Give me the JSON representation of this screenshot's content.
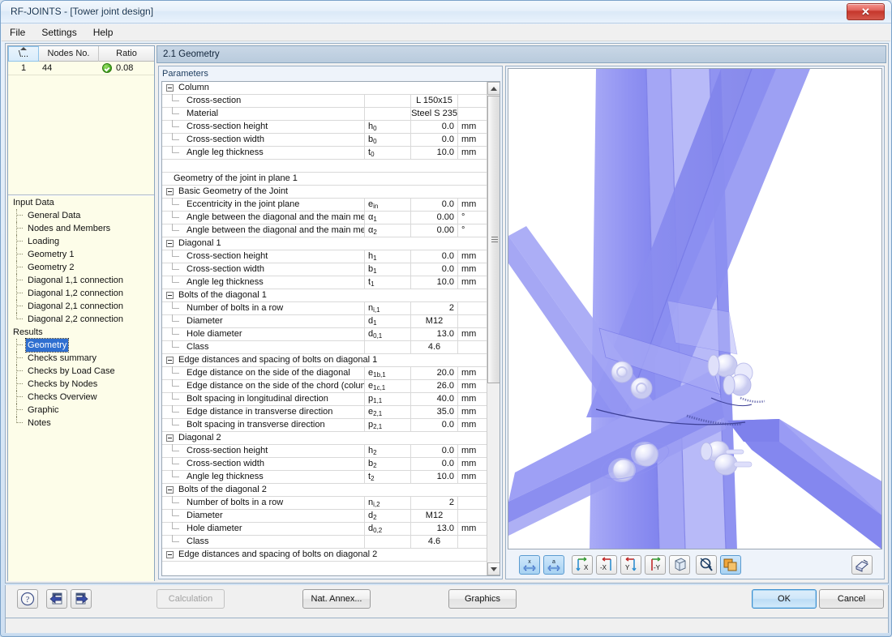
{
  "window": {
    "title": "RF-JOINTS - [Tower joint design]",
    "close_label": "✕"
  },
  "menu": {
    "items": [
      {
        "label": "File"
      },
      {
        "label": "Settings"
      },
      {
        "label": "Help"
      }
    ]
  },
  "nodes_grid": {
    "columns": [
      "\\...",
      "Nodes No.",
      "Ratio"
    ],
    "rows": [
      {
        "no": "1",
        "node": "44",
        "ratio": "0.08",
        "status_icon": "green-check-icon"
      }
    ]
  },
  "nav": {
    "groups": [
      {
        "label": "Input Data",
        "items": [
          {
            "label": "General Data"
          },
          {
            "label": "Nodes and Members"
          },
          {
            "label": "Loading"
          },
          {
            "label": "Geometry 1"
          },
          {
            "label": "Geometry 2"
          },
          {
            "label": "Diagonal 1,1 connection"
          },
          {
            "label": "Diagonal 1,2 connection"
          },
          {
            "label": "Diagonal 2,1 connection"
          },
          {
            "label": "Diagonal 2,2 connection"
          }
        ]
      },
      {
        "label": "Results",
        "items": [
          {
            "label": "Geometry",
            "selected": true
          },
          {
            "label": "Checks summary"
          },
          {
            "label": "Checks by Load Case"
          },
          {
            "label": "Checks by Nodes"
          },
          {
            "label": "Checks Overview"
          },
          {
            "label": "Graphic"
          },
          {
            "label": "Notes"
          }
        ]
      }
    ]
  },
  "content": {
    "header": "2.1 Geometry",
    "parameters_label": "Parameters"
  },
  "table": {
    "rows": [
      {
        "kind": "group",
        "name": "Column"
      },
      {
        "kind": "leaf",
        "name": "Cross-section",
        "sym": "",
        "val": "L 150x15",
        "unit": "",
        "val_align": "center"
      },
      {
        "kind": "leaf",
        "name": "Material",
        "sym": "",
        "val": "Steel S 235",
        "unit": "",
        "val_align": "center"
      },
      {
        "kind": "leaf",
        "name": "Cross-section height",
        "sym": "h",
        "sub": "0",
        "val": "0.0",
        "unit": "mm"
      },
      {
        "kind": "leaf",
        "name": "Cross-section width",
        "sym": "b",
        "sub": "0",
        "val": "0.0",
        "unit": "mm"
      },
      {
        "kind": "leaf",
        "name": "Angle leg thickness",
        "sym": "t",
        "sub": "0",
        "val": "10.0",
        "unit": "mm",
        "last": true
      },
      {
        "kind": "blank",
        "name": ""
      },
      {
        "kind": "plain",
        "name": "Geometry of the joint in plane 1"
      },
      {
        "kind": "group",
        "name": "Basic Geometry of the Joint"
      },
      {
        "kind": "leaf",
        "name": "Eccentricity in the joint plane",
        "sym": "e",
        "sub": "in",
        "val": "0.0",
        "unit": "mm"
      },
      {
        "kind": "leaf",
        "name": "Angle between the diagonal and the main me",
        "sym": "α",
        "sub": "1",
        "val": "0.00",
        "unit": "°"
      },
      {
        "kind": "leaf",
        "name": "Angle between the diagonal and the main me",
        "sym": "α",
        "sub": "2",
        "val": "0.00",
        "unit": "°",
        "last": true
      },
      {
        "kind": "group",
        "name": "Diagonal 1"
      },
      {
        "kind": "leaf",
        "name": "Cross-section height",
        "sym": "h",
        "sub": "1",
        "val": "0.0",
        "unit": "mm"
      },
      {
        "kind": "leaf",
        "name": "Cross-section width",
        "sym": "b",
        "sub": "1",
        "val": "0.0",
        "unit": "mm"
      },
      {
        "kind": "leaf",
        "name": "Angle leg thickness",
        "sym": "t",
        "sub": "1",
        "val": "10.0",
        "unit": "mm",
        "last": true
      },
      {
        "kind": "group",
        "name": "Bolts of the diagonal 1"
      },
      {
        "kind": "leaf",
        "name": "Number of bolts in a row",
        "sym": "n",
        "sub": "i,1",
        "val": "2",
        "unit": ""
      },
      {
        "kind": "leaf",
        "name": "Diameter",
        "sym": "d",
        "sub": "1",
        "val": "M12",
        "unit": "",
        "val_align": "center"
      },
      {
        "kind": "leaf",
        "name": "Hole diameter",
        "sym": "d",
        "sub": "0,1",
        "val": "13.0",
        "unit": "mm"
      },
      {
        "kind": "leaf",
        "name": "Class",
        "sym": "",
        "val": "4.6",
        "unit": "",
        "val_align": "center",
        "last": true
      },
      {
        "kind": "group",
        "name": "Edge distances and spacing of bolts on diagonal 1"
      },
      {
        "kind": "leaf",
        "name": "Edge distance on the side of the diagonal",
        "sym": "e",
        "sub": "1b,1",
        "val": "20.0",
        "unit": "mm"
      },
      {
        "kind": "leaf",
        "name": "Edge distance on the side of the chord (colun",
        "sym": "e",
        "sub": "1c,1",
        "val": "26.0",
        "unit": "mm"
      },
      {
        "kind": "leaf",
        "name": "Bolt spacing in longitudinal direction",
        "sym": "p",
        "sub": "1,1",
        "val": "40.0",
        "unit": "mm"
      },
      {
        "kind": "leaf",
        "name": "Edge distance in transverse direction",
        "sym": "e",
        "sub": "2,1",
        "val": "35.0",
        "unit": "mm"
      },
      {
        "kind": "leaf",
        "name": "Bolt spacing in transverse direction",
        "sym": "p",
        "sub": "2,1",
        "val": "0.0",
        "unit": "mm",
        "last": true
      },
      {
        "kind": "group",
        "name": "Diagonal 2"
      },
      {
        "kind": "leaf",
        "name": "Cross-section height",
        "sym": "h",
        "sub": "2",
        "val": "0.0",
        "unit": "mm"
      },
      {
        "kind": "leaf",
        "name": "Cross-section width",
        "sym": "b",
        "sub": "2",
        "val": "0.0",
        "unit": "mm"
      },
      {
        "kind": "leaf",
        "name": "Angle leg thickness",
        "sym": "t",
        "sub": "2",
        "val": "10.0",
        "unit": "mm",
        "last": true
      },
      {
        "kind": "group",
        "name": "Bolts of the diagonal 2"
      },
      {
        "kind": "leaf",
        "name": "Number of bolts in a row",
        "sym": "n",
        "sub": "i,2",
        "val": "2",
        "unit": ""
      },
      {
        "kind": "leaf",
        "name": "Diameter",
        "sym": "d",
        "sub": "2",
        "val": "M12",
        "unit": "",
        "val_align": "center"
      },
      {
        "kind": "leaf",
        "name": "Hole diameter",
        "sym": "d",
        "sub": "0,2",
        "val": "13.0",
        "unit": "mm"
      },
      {
        "kind": "leaf",
        "name": "Class",
        "sym": "",
        "val": "4.6",
        "unit": "",
        "val_align": "center",
        "last": true
      },
      {
        "kind": "group",
        "name": "Edge distances and spacing of bolts on diagonal 2"
      }
    ]
  },
  "graphics": {
    "toolbar": [
      {
        "icon": "zoom-fit-x-icon",
        "active": true
      },
      {
        "icon": "zoom-fit-all-icon",
        "active": true
      },
      {
        "icon": "view-x-icon",
        "active": false
      },
      {
        "icon": "view-negative-x-icon",
        "active": false
      },
      {
        "icon": "view-y-icon",
        "active": false
      },
      {
        "icon": "view-negative-y-icon",
        "active": false
      },
      {
        "icon": "isometric-view-icon",
        "active": false
      },
      {
        "icon": "zoom-reset-icon",
        "active": false
      },
      {
        "icon": "render-mode-icon",
        "active": true
      }
    ],
    "print_icon": "printer-icon"
  },
  "footer": {
    "help_icon": "help-icon",
    "prev_icon": "previous-arrow-icon",
    "next_icon": "next-arrow-icon",
    "calculation_label": "Calculation",
    "nat_annex_label": "Nat. Annex...",
    "graphics_label": "Graphics",
    "ok_label": "OK",
    "cancel_label": "Cancel"
  },
  "colors": {
    "accent": "#2f6fd0",
    "steel": "#7b7ef0",
    "title_bg": "#e6f0fa",
    "header_bg": "#c2d3e4"
  }
}
